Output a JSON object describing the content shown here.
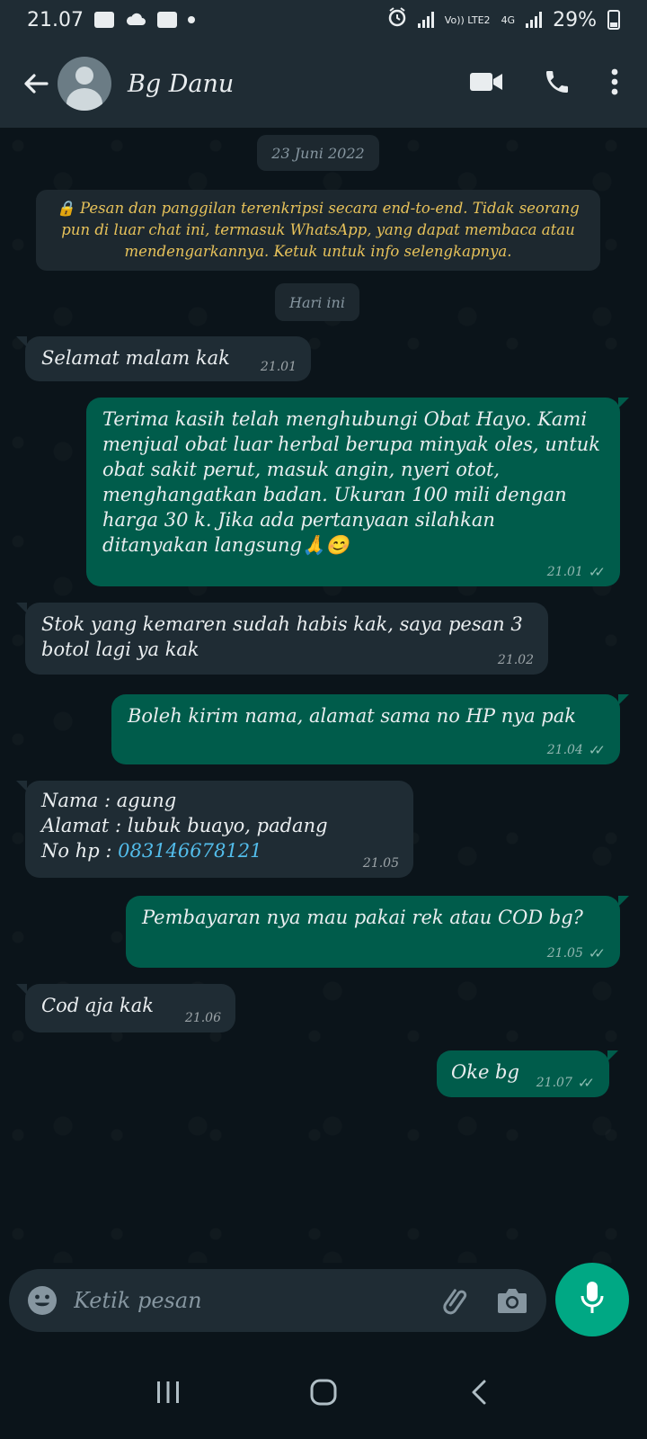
{
  "status_bar": {
    "time": "21.07",
    "network_label": "Vo)) LTE2",
    "network_type": "4G",
    "battery": "29%",
    "battery_level": 0.29
  },
  "header": {
    "contact_name": "Bg Danu",
    "icons": [
      "back-arrow-icon",
      "avatar",
      "video-call-icon",
      "phone-icon",
      "more-vert-icon"
    ]
  },
  "chat": {
    "date_pill": "23 Juni 2022",
    "encryption_notice": "🔒 Pesan dan panggilan terenkripsi secara end-to-end. Tidak seorang pun di luar chat ini, termasuk WhatsApp, yang dapat membaca atau mendengarkannya. Ketuk untuk info selengkapnya.",
    "today_pill": "Hari ini",
    "messages": [
      {
        "direction": "in",
        "text": "Selamat malam kak",
        "time": "21.01"
      },
      {
        "direction": "out",
        "text": "Terima kasih telah menghubungi Obat Hayo. Kami menjual obat luar herbal berupa minyak oles, untuk obat sakit perut, masuk angin, nyeri otot, menghangatkan badan. Ukuran 100 mili dengan harga 30 k. Jika ada pertanyaan silahkan ditanyakan langsung🙏😊",
        "time": "21.01"
      },
      {
        "direction": "in",
        "text": "Stok yang kemaren sudah habis kak, saya pesan 3 botol lagi ya kak",
        "time": "21.02"
      },
      {
        "direction": "out",
        "text": "Boleh kirim nama, alamat sama no HP nya pak",
        "time": "21.04"
      },
      {
        "direction": "in",
        "line1": "Nama : agung",
        "line2": "Alamat : lubuk buayo, padang",
        "line3_label": "No hp : ",
        "line3_phone": "083146678121",
        "time": "21.05"
      },
      {
        "direction": "out",
        "text": "Pembayaran nya mau pakai rek atau COD bg?",
        "time": "21.05"
      },
      {
        "direction": "in",
        "text": "Cod aja kak",
        "time": "21.06"
      },
      {
        "direction": "out",
        "text": "Oke bg",
        "time": "21.07"
      }
    ],
    "read_receipt_icon": "double-check-icon"
  },
  "composer": {
    "placeholder": "Ketik pesan",
    "icons": [
      "emoji-icon",
      "attach-icon",
      "camera-icon",
      "mic-icon"
    ]
  },
  "nav": {
    "icons": [
      "recent-apps-icon",
      "home-icon",
      "back-icon"
    ]
  },
  "colors": {
    "background": "#0b141a",
    "bar": "#1f2c34",
    "incoming": "#1f2c34",
    "outgoing": "#005c4b",
    "accent": "#00a884",
    "encryption_text": "#e7c25a",
    "link": "#53bdeb"
  }
}
